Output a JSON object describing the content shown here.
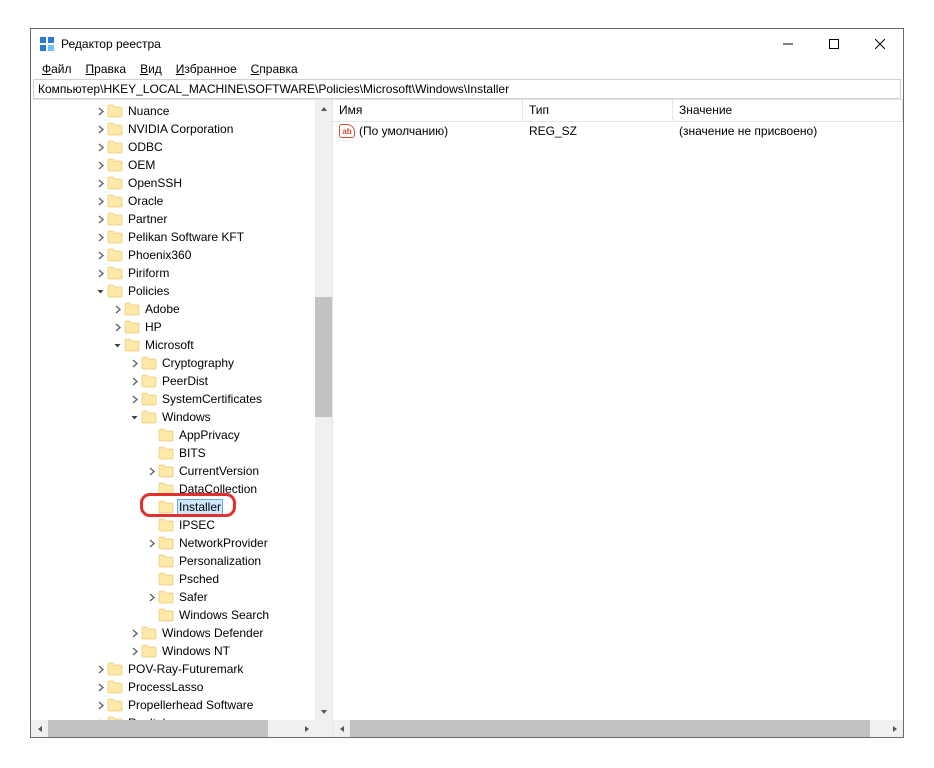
{
  "window": {
    "title": "Редактор реестра"
  },
  "menu": {
    "file": "Файл",
    "edit": "Правка",
    "view": "Вид",
    "favorites": "Избранное",
    "help": "Справка"
  },
  "address": "Компьютер\\HKEY_LOCAL_MACHINE\\SOFTWARE\\Policies\\Microsoft\\Windows\\Installer",
  "tree": [
    {
      "indent": 2,
      "toggle": ">",
      "label": "Nuance"
    },
    {
      "indent": 2,
      "toggle": ">",
      "label": "NVIDIA Corporation"
    },
    {
      "indent": 2,
      "toggle": ">",
      "label": "ODBC"
    },
    {
      "indent": 2,
      "toggle": ">",
      "label": "OEM"
    },
    {
      "indent": 2,
      "toggle": ">",
      "label": "OpenSSH"
    },
    {
      "indent": 2,
      "toggle": ">",
      "label": "Oracle"
    },
    {
      "indent": 2,
      "toggle": ">",
      "label": "Partner"
    },
    {
      "indent": 2,
      "toggle": ">",
      "label": "Pelikan Software KFT"
    },
    {
      "indent": 2,
      "toggle": ">",
      "label": "Phoenix360"
    },
    {
      "indent": 2,
      "toggle": ">",
      "label": "Piriform"
    },
    {
      "indent": 2,
      "toggle": "v",
      "label": "Policies"
    },
    {
      "indent": 3,
      "toggle": ">",
      "label": "Adobe"
    },
    {
      "indent": 3,
      "toggle": ">",
      "label": "HP"
    },
    {
      "indent": 3,
      "toggle": "v",
      "label": "Microsoft"
    },
    {
      "indent": 4,
      "toggle": ">",
      "label": "Cryptography"
    },
    {
      "indent": 4,
      "toggle": ">",
      "label": "PeerDist"
    },
    {
      "indent": 4,
      "toggle": ">",
      "label": "SystemCertificates"
    },
    {
      "indent": 4,
      "toggle": "v",
      "label": "Windows"
    },
    {
      "indent": 5,
      "toggle": "",
      "label": "AppPrivacy"
    },
    {
      "indent": 5,
      "toggle": "",
      "label": "BITS"
    },
    {
      "indent": 5,
      "toggle": ">",
      "label": "CurrentVersion"
    },
    {
      "indent": 5,
      "toggle": "",
      "label": "DataCollection"
    },
    {
      "indent": 5,
      "toggle": "",
      "label": "Installer",
      "selected": true,
      "highlight": true
    },
    {
      "indent": 5,
      "toggle": "",
      "label": "IPSEC"
    },
    {
      "indent": 5,
      "toggle": ">",
      "label": "NetworkProvider"
    },
    {
      "indent": 5,
      "toggle": "",
      "label": "Personalization"
    },
    {
      "indent": 5,
      "toggle": "",
      "label": "Psched"
    },
    {
      "indent": 5,
      "toggle": ">",
      "label": "Safer"
    },
    {
      "indent": 5,
      "toggle": "",
      "label": "Windows Search"
    },
    {
      "indent": 4,
      "toggle": ">",
      "label": "Windows Defender"
    },
    {
      "indent": 4,
      "toggle": ">",
      "label": "Windows NT"
    },
    {
      "indent": 2,
      "toggle": ">",
      "label": "POV-Ray-Futuremark"
    },
    {
      "indent": 2,
      "toggle": ">",
      "label": "ProcessLasso"
    },
    {
      "indent": 2,
      "toggle": ">",
      "label": "Propellerhead Software"
    },
    {
      "indent": 2,
      "toggle": ">",
      "label": "Realtek"
    }
  ],
  "list": {
    "columns": {
      "name": "Имя",
      "type": "Тип",
      "value": "Значение"
    },
    "rows": [
      {
        "name": "(По умолчанию)",
        "type": "REG_SZ",
        "value": "(значение не присвоено)"
      }
    ]
  }
}
